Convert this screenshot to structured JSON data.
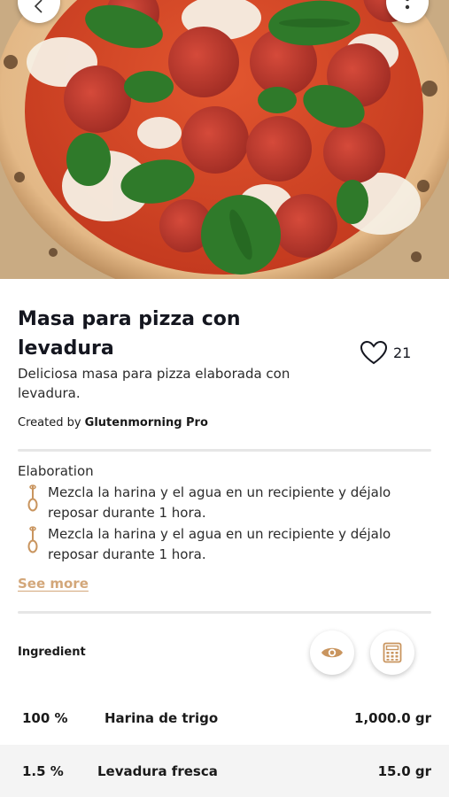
{
  "recipe": {
    "title": "Masa para pizza con levadura",
    "title_line1": "Masa para pizza con",
    "title_line2": "levadura",
    "description": "Deliciosa masa para pizza elaborada con levadura.",
    "created_by_prefix": "Created by",
    "author": "Glutenmorning Pro",
    "likes": "21"
  },
  "elaboration": {
    "heading": "Elaboration",
    "steps": [
      "Mezcla la harina y el agua en un recipiente y déjalo reposar durante 1 hora.",
      "Mezcla la harina y el agua en un recipiente y déjalo reposar durante 1 hora."
    ],
    "see_more": "See more"
  },
  "ingredients": {
    "heading": "Ingredient",
    "rows": [
      {
        "percent": "100 %",
        "name": "Harina de trigo",
        "quantity": "1,000.0 gr"
      },
      {
        "percent": "1.5 %",
        "name": "Levadura fresca",
        "quantity": "15.0 gr"
      }
    ]
  },
  "icons": {
    "back": "chevron-left-icon",
    "menu": "more-vertical-icon",
    "like": "heart-icon",
    "step": "whisk-icon",
    "view": "eye-icon",
    "calculator": "calculator-icon"
  },
  "colors": {
    "accent": "#d3a77a",
    "text": "#14161f",
    "divider": "#e6e6e6",
    "row_alt": "#f4f4f4"
  }
}
